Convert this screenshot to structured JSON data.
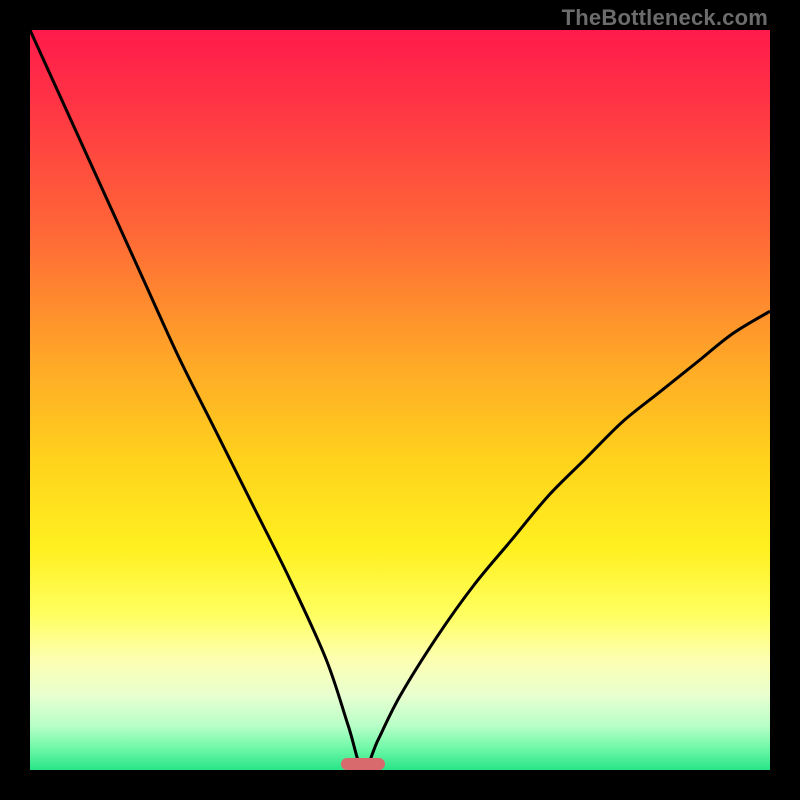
{
  "watermark": {
    "text": "TheBottleneck.com"
  },
  "colors": {
    "black": "#000000",
    "curve": "#000000",
    "marker": "#d86a6e",
    "watermark": "#6c6c6c"
  },
  "gradient": {
    "stops": [
      {
        "pct": 0,
        "color": "#ff1a4b"
      },
      {
        "pct": 12,
        "color": "#ff3a43"
      },
      {
        "pct": 28,
        "color": "#ff6a36"
      },
      {
        "pct": 44,
        "color": "#ffa528"
      },
      {
        "pct": 58,
        "color": "#ffd21c"
      },
      {
        "pct": 70,
        "color": "#fff020"
      },
      {
        "pct": 79,
        "color": "#ffff60"
      },
      {
        "pct": 85,
        "color": "#fdffb0"
      },
      {
        "pct": 90,
        "color": "#e8ffd0"
      },
      {
        "pct": 94,
        "color": "#b8ffc8"
      },
      {
        "pct": 97,
        "color": "#70f8a8"
      },
      {
        "pct": 100,
        "color": "#28e488"
      }
    ]
  },
  "chart_data": {
    "type": "line",
    "title": "",
    "xlabel": "",
    "ylabel": "",
    "xlim": [
      0,
      100
    ],
    "ylim": [
      0,
      100
    ],
    "note": "V-shaped bottleneck curve. y is mismatch percentage; minimum (≈0) occurs near x≈45. Curve rises steeply to ~100 at x=0 and to ~62 at x=100.",
    "series": [
      {
        "name": "bottleneck-curve",
        "x": [
          0,
          5,
          10,
          15,
          20,
          25,
          30,
          35,
          40,
          43,
          45,
          47,
          50,
          55,
          60,
          65,
          70,
          75,
          80,
          85,
          90,
          95,
          100
        ],
        "y": [
          100,
          89,
          78,
          67,
          56,
          46,
          36,
          26,
          15,
          6,
          0,
          4,
          10,
          18,
          25,
          31,
          37,
          42,
          47,
          51,
          55,
          59,
          62
        ]
      }
    ],
    "marker": {
      "x_center": 45,
      "x_width": 6,
      "y": 0
    }
  }
}
